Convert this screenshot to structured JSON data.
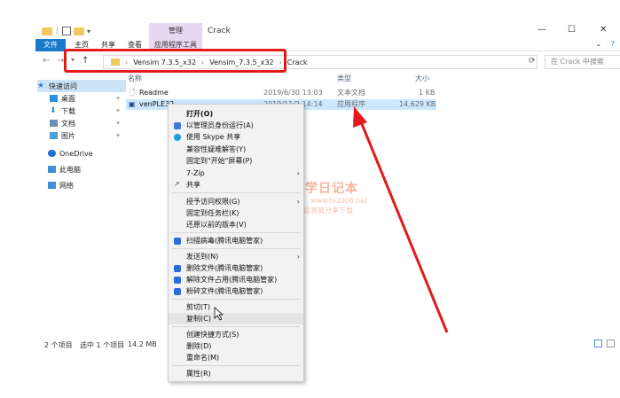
{
  "window": {
    "title": "Crack",
    "manage_tab": "管理",
    "controls": {
      "minimize": "—",
      "maximize": "☐",
      "close": "✕"
    }
  },
  "ribbon": {
    "tabs": [
      {
        "label": "文件"
      },
      {
        "label": "主页"
      },
      {
        "label": "共享"
      },
      {
        "label": "查看"
      },
      {
        "label": "应用程序工具"
      }
    ],
    "expand": "⌄",
    "help": "?"
  },
  "address": {
    "segments": [
      "Vensim 7.3.5_x32",
      "Vensim_7.3.5_x32",
      "Crack"
    ],
    "search_placeholder": "在 Crack 中搜索",
    "refresh_icon": "refresh-icon"
  },
  "sidebar": {
    "items": [
      {
        "label": "快速访问",
        "icon": "star-icon",
        "color": "#3a7bd5"
      },
      {
        "label": "桌面",
        "icon": "desktop-icon",
        "color": "#2e8ee0",
        "pinned": "📌"
      },
      {
        "label": "下载",
        "icon": "download-icon",
        "color": "#2e8ee0",
        "pinned": "📌"
      },
      {
        "label": "文档",
        "icon": "documents-icon",
        "color": "#6c8fb8",
        "pinned": "📌"
      },
      {
        "label": "图片",
        "icon": "pictures-icon",
        "color": "#4aa0d8",
        "pinned": "📌"
      },
      {
        "label": "OneDrive",
        "icon": "cloud-icon",
        "color": "#1e74d0"
      },
      {
        "label": "此电脑",
        "icon": "computer-icon",
        "color": "#3d8fd8"
      },
      {
        "label": "网络",
        "icon": "network-icon",
        "color": "#3d8fd8"
      }
    ]
  },
  "files": {
    "columns": [
      "名称",
      "类型",
      "大小"
    ],
    "rows": [
      {
        "name": "Readme",
        "date": "2019/6/30 13:03",
        "type": "文本文档",
        "size": "1 KB"
      },
      {
        "name": "venPLE32",
        "date": "2019/11/2 14:14",
        "type": "应用程序",
        "size": "14,629 KB"
      }
    ]
  },
  "status": {
    "count": "2 个项目",
    "selected": "选中 1 个项目",
    "size": "14.2 MB"
  },
  "context_menu": {
    "items": [
      {
        "label": "打开(O)",
        "bold": true
      },
      {
        "label": "以管理员身份运行(A)",
        "icon": "shield-icon",
        "color": "#3f7ad6"
      },
      {
        "label": "使用 Skype 共享",
        "icon": "skype-icon",
        "color": "#1a9fe0"
      },
      {
        "label": "兼容性疑难解答(Y)"
      },
      {
        "label": "固定到\"开始\"屏幕(P)"
      },
      {
        "label": "7-Zip",
        "submenu": "›"
      },
      {
        "label": "共享",
        "icon": "share-icon",
        "color": "#444"
      },
      {
        "label": "授予访问权限(G)",
        "submenu": "›"
      },
      {
        "label": "固定到任务栏(K)"
      },
      {
        "label": "还原以前的版本(V)"
      },
      {
        "label": "扫描病毒(腾讯电脑管家)",
        "icon": "tencent-shield-icon",
        "color": "#2b6bdc"
      },
      {
        "label": "发送到(N)",
        "submenu": "›"
      },
      {
        "label": "删除文件(腾讯电脑管家)",
        "icon": "tencent-delete-icon",
        "color": "#2b6bdc"
      },
      {
        "label": "解除文件占用(腾讯电脑管家)",
        "icon": "tencent-unlock-icon",
        "color": "#2b6bdc"
      },
      {
        "label": "粉碎文件(腾讯电脑管家)",
        "icon": "tencent-shred-icon",
        "color": "#2b6bdc"
      },
      {
        "label": "剪切(T)"
      },
      {
        "label": "复制(C)"
      },
      {
        "label": "创建快捷方式(S)"
      },
      {
        "label": "删除(D)"
      },
      {
        "label": "重命名(M)"
      },
      {
        "label": "属性(R)"
      }
    ]
  },
  "watermark": {
    "title": "丁同学日记本",
    "url": "www.txz006.net",
    "subtitle": "软件、资源、资料网盘直链分享下载"
  },
  "colors": {
    "accent": "#1979ca",
    "highlight": "#e41a1a",
    "selection": "#cce8ff"
  }
}
